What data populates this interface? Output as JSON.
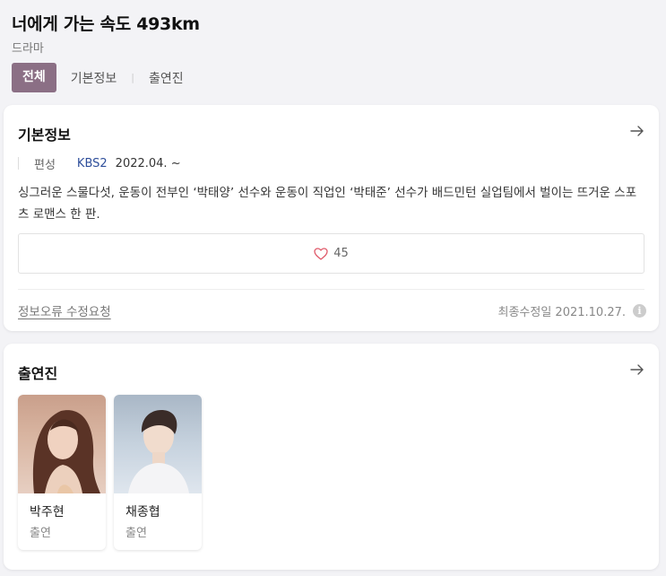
{
  "header": {
    "title": "너에게 가는 속도 493km",
    "genre": "드라마",
    "tabs": [
      {
        "label": "전체"
      },
      {
        "label": "기본정보"
      },
      {
        "label": "출연진"
      }
    ]
  },
  "info_card": {
    "title": "기본정보",
    "meta_label": "편성",
    "channel": "KBS2",
    "date": "2022.04. ~",
    "description": "싱그러운 스물다섯, 운동이 전부인 ‘박태양’ 선수와 운동이 직업인 ‘박태준’ 선수가 배드민턴 실업팀에서 벌이는 뜨거운 스포츠 로맨스 한 판.",
    "likes": "45",
    "report_link": "정보오류 수정요청",
    "updated": "최종수정일 2021.10.27.",
    "info_icon_glyph": "i"
  },
  "cast_card": {
    "title": "출연진",
    "members": [
      {
        "name": "박주현",
        "role": "출연"
      },
      {
        "name": "채종협",
        "role": "출연"
      }
    ]
  },
  "colors": {
    "accent": "#8b6f85",
    "channel_link": "#2f4f9b",
    "heart": "#e05a6a",
    "page_bg": "#f3f3f6"
  },
  "icons": {
    "card_arrow": "arrow-right-icon",
    "like": "heart-icon",
    "updated_info": "info-icon"
  }
}
